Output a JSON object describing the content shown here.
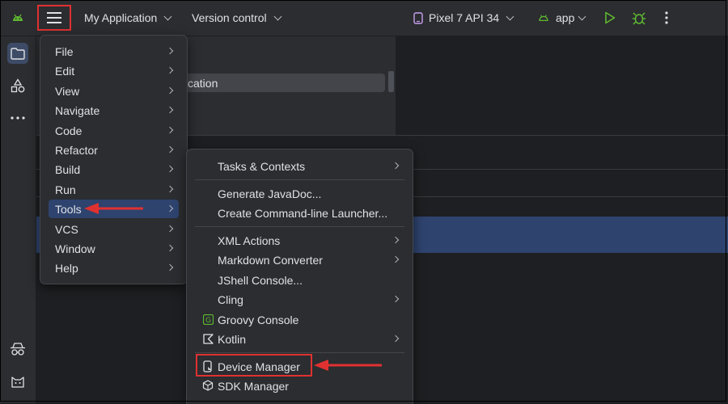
{
  "titlebar": {
    "project_name": "My Application",
    "vcs_label": "Version control",
    "device_label": "Pixel 7 API 34",
    "run_config": "app"
  },
  "background": {
    "fragment_text": "cation"
  },
  "main_menu": {
    "items": [
      {
        "label": "File"
      },
      {
        "label": "Edit"
      },
      {
        "label": "View"
      },
      {
        "label": "Navigate"
      },
      {
        "label": "Code"
      },
      {
        "label": "Refactor"
      },
      {
        "label": "Build"
      },
      {
        "label": "Run"
      },
      {
        "label": "Tools"
      },
      {
        "label": "VCS"
      },
      {
        "label": "Window"
      },
      {
        "label": "Help"
      }
    ]
  },
  "tools_menu": {
    "items": [
      {
        "label": "Tasks & Contexts"
      },
      {
        "label": "Generate JavaDoc..."
      },
      {
        "label": "Create Command-line Launcher..."
      },
      {
        "label": "XML Actions"
      },
      {
        "label": "Markdown Converter"
      },
      {
        "label": "JShell Console..."
      },
      {
        "label": "Cling"
      },
      {
        "label": "Groovy Console"
      },
      {
        "label": "Kotlin"
      },
      {
        "label": "Device Manager"
      },
      {
        "label": "SDK Manager"
      }
    ]
  },
  "colors": {
    "accent_red": "#e03131",
    "selection": "#2e436e",
    "android_green": "#5fb832",
    "run_green": "#5fb832"
  }
}
